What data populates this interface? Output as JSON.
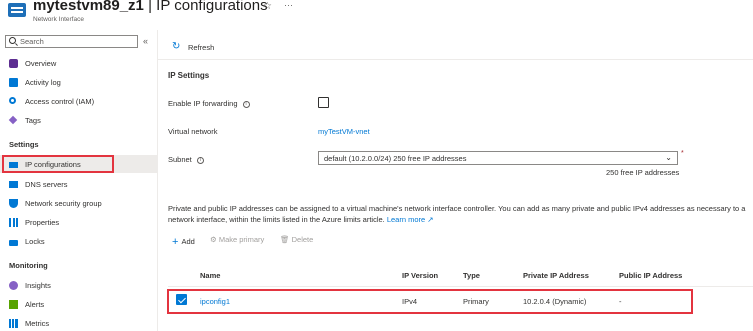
{
  "header": {
    "resource_name": "mytestvm89_z1",
    "separator": "|",
    "page_title": "IP configurations",
    "subtitle": "Network Interface",
    "star_glyph": "☆",
    "more_glyph": "···"
  },
  "sidebar": {
    "search_placeholder": "Search",
    "collapse_glyph": "«",
    "items_top": [
      {
        "label": "Overview",
        "icon": "overview-icon"
      },
      {
        "label": "Activity log",
        "icon": "activity-log-icon"
      },
      {
        "label": "Access control (IAM)",
        "icon": "iam-icon"
      },
      {
        "label": "Tags",
        "icon": "tag-icon"
      }
    ],
    "settings_header": "Settings",
    "settings_items": [
      {
        "label": "IP configurations",
        "icon": "ip-config-icon",
        "selected": true
      },
      {
        "label": "DNS servers",
        "icon": "dns-icon"
      },
      {
        "label": "Network security group",
        "icon": "shield-icon"
      },
      {
        "label": "Properties",
        "icon": "properties-icon"
      },
      {
        "label": "Locks",
        "icon": "lock-icon"
      }
    ],
    "monitoring_header": "Monitoring",
    "monitoring_items": [
      {
        "label": "Insights",
        "icon": "insights-icon"
      },
      {
        "label": "Alerts",
        "icon": "alerts-icon"
      },
      {
        "label": "Metrics",
        "icon": "metrics-icon"
      }
    ]
  },
  "toolbar": {
    "refresh_label": "Refresh",
    "refresh_glyph": "↻"
  },
  "ip_settings": {
    "heading": "IP Settings",
    "ip_forwarding_label": "Enable IP forwarding",
    "ip_forwarding_checked": false,
    "virtual_network_label": "Virtual network",
    "virtual_network_value": "myTestVM-vnet",
    "subnet_label": "Subnet",
    "subnet_value": "default (10.2.0.0/24) 250 free IP addresses",
    "subnet_free": "250 free IP addresses",
    "required_marker": "*",
    "info_glyph": "i"
  },
  "description": {
    "text": "Private and public IP addresses can be assigned to a virtual machine's network interface controller. You can add as many private and public IPv4 addresses as necessary to a network interface, within the limits listed in the Azure limits article.",
    "learn_more": "Learn more ↗"
  },
  "actions": {
    "add": "Add",
    "add_glyph": "+",
    "make_primary": "Make primary",
    "make_primary_glyph": "⚙",
    "delete": "Delete",
    "delete_glyph": "🗑"
  },
  "table": {
    "columns": [
      "Name",
      "IP Version",
      "Type",
      "Private IP Address",
      "Public IP Address"
    ],
    "rows": [
      {
        "name": "ipconfig1",
        "ip_version": "IPv4",
        "type": "Primary",
        "private_ip": "10.2.0.4 (Dynamic)",
        "public_ip": "-",
        "selected": true
      }
    ]
  },
  "colors": {
    "accent": "#0078d4",
    "highlight_border": "#e3343f",
    "selected_bg": "#edebe9"
  }
}
